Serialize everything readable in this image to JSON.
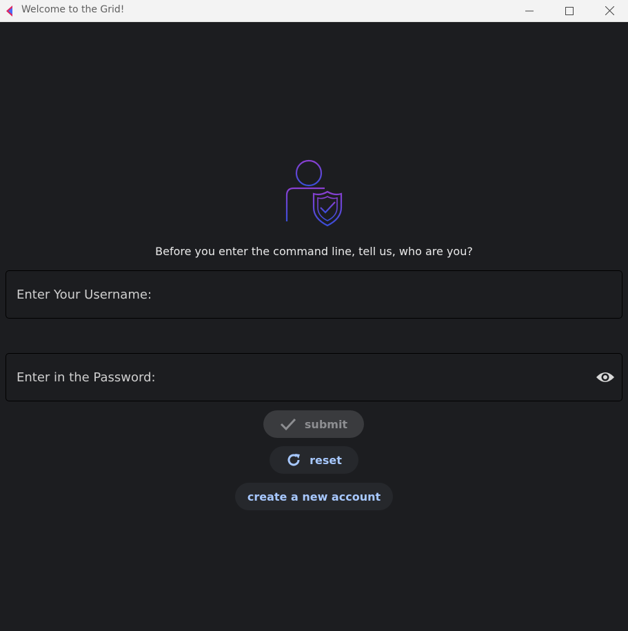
{
  "window": {
    "title": "Welcome to the Grid!",
    "icons": {
      "app": "app-logo-icon",
      "minimize": "minimize-icon",
      "maximize": "maximize-icon",
      "close": "close-icon"
    }
  },
  "hero": {
    "icon": "user-shield-icon",
    "prompt": "Before you enter the command line, tell us, who are you?"
  },
  "form": {
    "username_label": "Enter Your Username:",
    "password_label": "Enter in the Password:",
    "password_toggle_icon": "eye-icon"
  },
  "buttons": {
    "submit": {
      "label": "submit",
      "icon": "check-icon"
    },
    "reset": {
      "label": "reset",
      "icon": "refresh-icon"
    },
    "create": {
      "label": "create a new account"
    }
  },
  "colors": {
    "background": "#1c1d20",
    "accent_text": "#a7c8ff",
    "icon_gradient_start": "#8a3fd1",
    "icon_gradient_end": "#3a4ed9",
    "titlebar": "#f3f3f3"
  }
}
